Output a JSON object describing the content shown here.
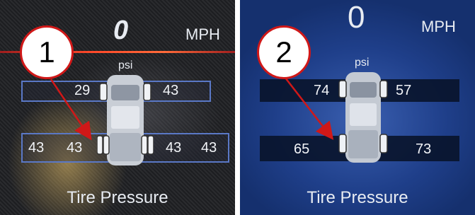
{
  "panels": [
    {
      "badge": "1",
      "speed": "0",
      "speed_unit": "MPH",
      "unit_label": "psi",
      "front_left": "29",
      "front_right": "43",
      "rear_left_outer": "43",
      "rear_left_inner": "43",
      "rear_right_inner": "43",
      "rear_right_outer": "43",
      "caption": "Tire Pressure"
    },
    {
      "badge": "2",
      "speed": "0",
      "speed_unit": "MPH",
      "unit_label": "psi",
      "front_left": "74",
      "front_right": "57",
      "rear_left": "65",
      "rear_right": "73",
      "caption": "Tire Pressure"
    }
  ],
  "colors": {
    "annotation_red": "#d01818",
    "band_border": "#5a78c6"
  },
  "icons": [
    "truck-icon",
    "arrow-icon"
  ]
}
